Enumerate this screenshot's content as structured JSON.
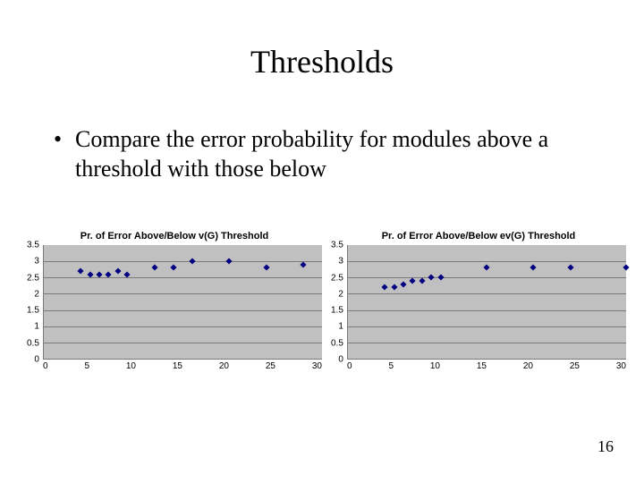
{
  "title": "Thresholds",
  "bullet_text": "Compare the error probability for modules above a threshold with those below",
  "page_number": "16",
  "charts": [
    {
      "title": "Pr. of Error Above/Below v(G) Threshold",
      "color": "#000080"
    },
    {
      "title": "Pr. of Error Above/Below ev(G) Threshold",
      "color": "#000080"
    }
  ],
  "y_ticks": [
    "3.5",
    "3",
    "2.5",
    "2",
    "1.5",
    "1",
    "0.5",
    "0"
  ],
  "x_ticks": [
    "0",
    "5",
    "10",
    "15",
    "20",
    "25",
    "30"
  ],
  "chart_data": [
    {
      "type": "scatter",
      "title": "Pr. of Error Above/Below v(G) Threshold",
      "xlabel": "",
      "ylabel": "",
      "xlim": [
        0,
        30
      ],
      "ylim": [
        0,
        3.5
      ],
      "x": [
        4,
        5,
        6,
        7,
        8,
        9,
        12,
        14,
        16,
        20,
        24,
        28
      ],
      "values": [
        2.7,
        2.6,
        2.6,
        2.6,
        2.7,
        2.6,
        2.8,
        2.8,
        3.0,
        3.0,
        2.8,
        2.9
      ]
    },
    {
      "type": "scatter",
      "title": "Pr. of Error Above/Below ev(G) Threshold",
      "xlabel": "",
      "ylabel": "",
      "xlim": [
        0,
        30
      ],
      "ylim": [
        0,
        3.5
      ],
      "x": [
        4,
        5,
        6,
        7,
        8,
        9,
        10,
        15,
        20,
        24,
        30
      ],
      "values": [
        2.2,
        2.2,
        2.3,
        2.4,
        2.4,
        2.5,
        2.5,
        2.8,
        2.8,
        2.8,
        2.8
      ]
    }
  ]
}
